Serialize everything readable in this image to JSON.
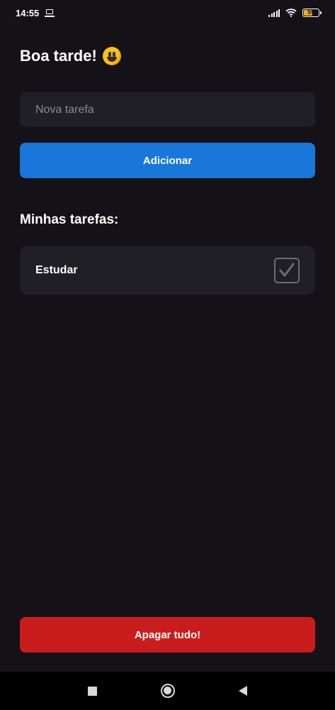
{
  "status_bar": {
    "time": "14:55",
    "battery_level": "59",
    "battery_percent": 59,
    "icons": [
      "laptop-icon",
      "signal-icon",
      "wifi-icon",
      "battery-icon"
    ]
  },
  "header": {
    "greeting": "Boa tarde!",
    "emoji_icon": "smiley-icon"
  },
  "new_task": {
    "placeholder": "Nova tarefa",
    "value": "",
    "add_label": "Adicionar"
  },
  "tasks_section": {
    "title": "Minhas tarefas:",
    "items": [
      {
        "label": "Estudar",
        "checked": true
      }
    ]
  },
  "footer": {
    "clear_label": "Apagar tudo!"
  },
  "nav_bar": {
    "icons": [
      "square-icon",
      "circle-icon",
      "back-icon"
    ]
  },
  "colors": {
    "background": "#141217",
    "card": "#201f26",
    "primary": "#1877d9",
    "danger": "#c91d1d",
    "battery": "#f2b51f"
  }
}
